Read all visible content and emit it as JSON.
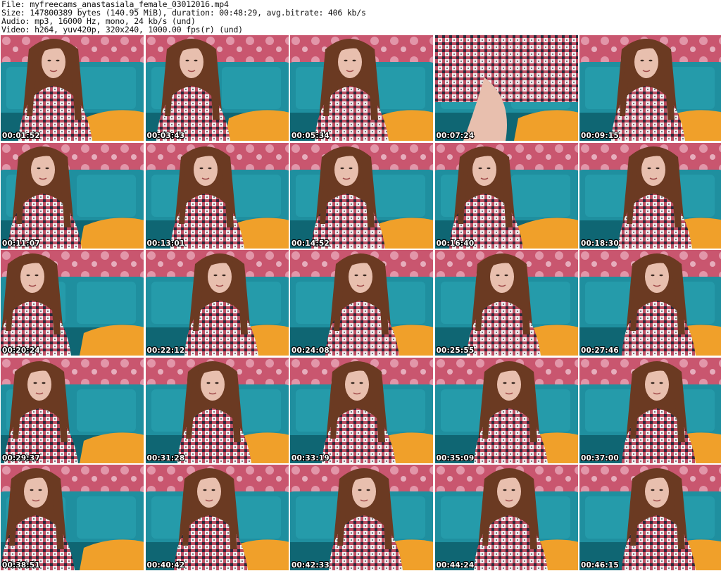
{
  "header": {
    "file_line": "File: myfreecams_anastasiala_female_03012016.mp4",
    "size_line": "Size: 147800389 bytes (140.95 MiB), duration: 00:48:29, avg.bitrate: 406 kb/s",
    "audio_line": "Audio: mp3, 16000 Hz, mono, 24 kb/s (und)",
    "video_line": "Video: h264, yuv420p, 320x240, 1000.00 fps(r) (und)"
  },
  "colors": {
    "wall": "#c9566f",
    "wall_light": "#e9a6b8",
    "sofa": "#1f8f9f",
    "sofa_dark": "#0f6673",
    "pillow": "#f0a02a",
    "hair": "#6b3a22",
    "skin": "#e8bfae",
    "shirt_red": "#b5314a",
    "shirt_white": "#eeeeee",
    "shirt_dark": "#2a2a3a"
  },
  "thumbnails": [
    {
      "timestamp": "00:01:52"
    },
    {
      "timestamp": "00:03:43"
    },
    {
      "timestamp": "00:05:34"
    },
    {
      "timestamp": "00:07:24"
    },
    {
      "timestamp": "00:09:15"
    },
    {
      "timestamp": "00:11:07"
    },
    {
      "timestamp": "00:13:01"
    },
    {
      "timestamp": "00:14:52"
    },
    {
      "timestamp": "00:16:40"
    },
    {
      "timestamp": "00:18:30"
    },
    {
      "timestamp": "00:20:24"
    },
    {
      "timestamp": "00:22:12"
    },
    {
      "timestamp": "00:24:08"
    },
    {
      "timestamp": "00:25:55"
    },
    {
      "timestamp": "00:27:46"
    },
    {
      "timestamp": "00:29:37"
    },
    {
      "timestamp": "00:31:28"
    },
    {
      "timestamp": "00:33:19"
    },
    {
      "timestamp": "00:35:09"
    },
    {
      "timestamp": "00:37:00"
    },
    {
      "timestamp": "00:38:51"
    },
    {
      "timestamp": "00:40:42"
    },
    {
      "timestamp": "00:42:33"
    },
    {
      "timestamp": "00:44:24"
    },
    {
      "timestamp": "00:46:15"
    }
  ]
}
